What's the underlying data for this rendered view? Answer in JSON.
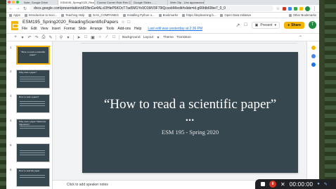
{
  "browser": {
    "tabs": [
      {
        "label": "Note, Google Drive"
      },
      {
        "label": "ESM195_Spring2020_Reading..."
      },
      {
        "label": "Course Corner Role Res Con"
      },
      {
        "label": "Google Slides - ..."
      },
      {
        "label": "Web Clip - Unc appearance"
      }
    ],
    "url": "docs.google.com/presentation/d/1fbnGe4ALcl3HleP6KOcT7ad5M1Yo9O1MV9F79lQcssbM/edit#slide=id.g66fdb69be7_0_0",
    "bookmarks": [
      {
        "label": "Apps"
      },
      {
        "label": "Introduction to Soci..."
      },
      {
        "label": "Teaching Help"
      },
      {
        "label": "EAS_COMPANIES"
      },
      {
        "label": "Installing Python o..."
      },
      {
        "label": "Bookmarks"
      },
      {
        "label": "https://iteplearning.b..."
      },
      {
        "label": "Open Data Initiative"
      }
    ],
    "other_bookmarks": "Other Bookmarks"
  },
  "slides": {
    "doc_title": "ESM195_Spring2020_ReadingScientificPapers",
    "menu": [
      "File",
      "Edit",
      "View",
      "Insert",
      "Format",
      "Slide",
      "Arrange",
      "Tools",
      "Add-ons",
      "Help"
    ],
    "last_edit": "Last edit was yesterday at 2:36 PM",
    "present_label": "Present",
    "share_label": "Share",
    "user_initial": "T",
    "toolbar": {
      "background": "Background",
      "layout": "Layout",
      "theme": "Theme",
      "transition": "Transition"
    },
    "thumbnails": [
      {
        "num": "1",
        "title": "“How to read a scientific paper”"
      },
      {
        "num": "2",
        "title": "Why read a paper?"
      },
      {
        "num": "3",
        "title": "How to read a paper?"
      },
      {
        "num": "4",
        "title": "Why read a paper? Skim fast objectives?"
      },
      {
        "num": "5",
        "title": ""
      },
      {
        "num": "6",
        "title": "How to read the paper"
      }
    ],
    "slide": {
      "title": "“How to read a scientific paper”",
      "dots": "•••",
      "subtitle": "ESM 195 - Spring 2020"
    },
    "notes_placeholder": "Click to add speaker notes",
    "colors": {
      "slide_bg": "#37474f",
      "accent": "#f4b400"
    }
  },
  "recorder": {
    "time": "00:00:00"
  }
}
